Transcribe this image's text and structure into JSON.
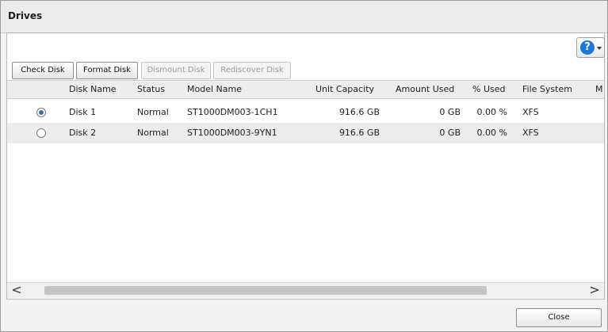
{
  "window": {
    "title": "Drives"
  },
  "toolbar": {
    "check_disk": "Check Disk",
    "format_disk": "Format Disk",
    "dismount_disk": "Dismount Disk",
    "rediscover_disk": "Rediscover Disk",
    "help_glyph": "?"
  },
  "table": {
    "columns": [
      "Disk Name",
      "Status",
      "Model Name",
      "Unit Capacity",
      "Amount Used",
      "% Used",
      "File System",
      "M"
    ],
    "rows": [
      {
        "selected": true,
        "disk_name": "Disk 1",
        "status": "Normal",
        "model_name": "ST1000DM003-1CH1",
        "unit_capacity": "916.6 GB",
        "amount_used": "0 GB",
        "pct_used": "0.00 %",
        "file_system": "XFS"
      },
      {
        "selected": false,
        "disk_name": "Disk 2",
        "status": "Normal",
        "model_name": "ST1000DM003-9YN1",
        "unit_capacity": "916.6 GB",
        "amount_used": "0 GB",
        "pct_used": "0.00 %",
        "file_system": "XFS"
      }
    ]
  },
  "scrollbar": {
    "left_arrow": "<",
    "right_arrow": ">"
  },
  "footer": {
    "close": "Close"
  },
  "colors": {
    "help_icon": "#1c78d6",
    "row_alt": "#ececec",
    "radio_selected": "#3d6fb0"
  }
}
